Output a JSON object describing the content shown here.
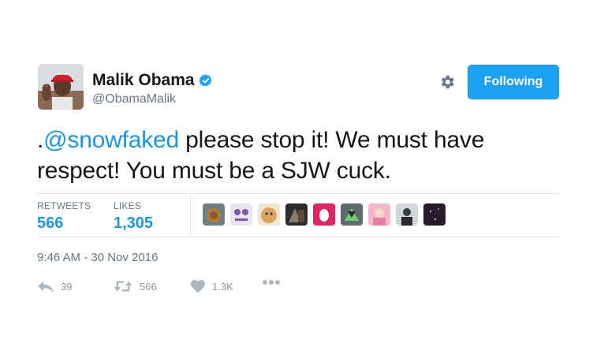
{
  "user": {
    "name": "Malik Obama",
    "handle": "@ObamaMalik"
  },
  "follow_button": {
    "label": "Following"
  },
  "tweet": {
    "prefix": ".",
    "mention": "@snowfaked",
    "body_line1": " please stop it! We must have",
    "body_line2": "respect! You must be a SJW cuck."
  },
  "stats": {
    "retweets_label": "RETWEETS",
    "retweets_value": "566",
    "likes_label": "LIKES",
    "likes_value": "1,305"
  },
  "timestamp": "9:46 AM - 30 Nov 2016",
  "actions": {
    "reply_count": "39",
    "retweet_count": "566",
    "like_count": "1.3K"
  },
  "colors": {
    "accent": "#1da1f2",
    "link": "#1b95e0",
    "muted": "#657786",
    "action_icon": "#aab8c2"
  }
}
